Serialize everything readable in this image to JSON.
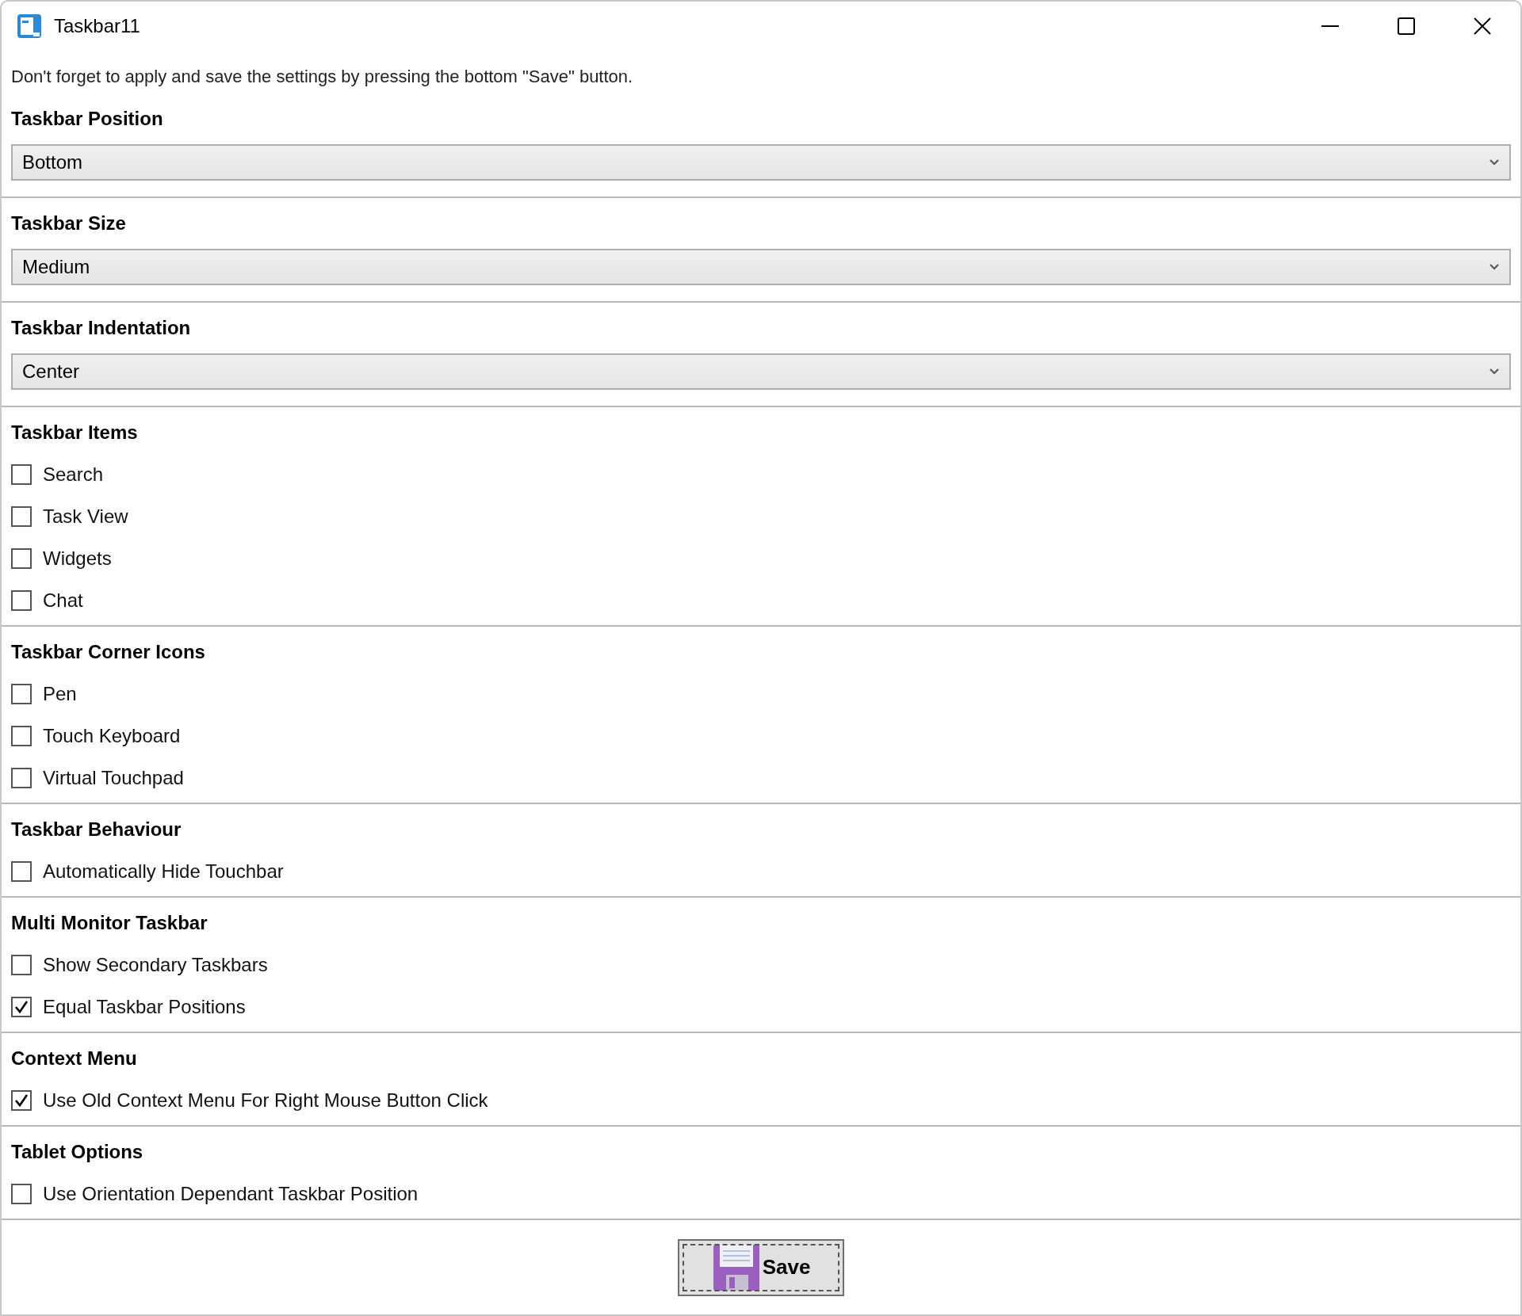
{
  "window": {
    "title": "Taskbar11"
  },
  "notice": "Don't forget to apply and save the settings by pressing the bottom \"Save\" button.",
  "sections": [
    {
      "title": "Taskbar Position",
      "kind": "dropdown",
      "value": "Bottom"
    },
    {
      "title": "Taskbar Size",
      "kind": "dropdown",
      "value": "Medium"
    },
    {
      "title": "Taskbar Indentation",
      "kind": "dropdown",
      "value": "Center"
    },
    {
      "title": "Taskbar Items",
      "kind": "checkboxes",
      "options": [
        {
          "label": "Search",
          "checked": false
        },
        {
          "label": "Task View",
          "checked": false
        },
        {
          "label": "Widgets",
          "checked": false
        },
        {
          "label": "Chat",
          "checked": false
        }
      ]
    },
    {
      "title": "Taskbar Corner Icons",
      "kind": "checkboxes",
      "options": [
        {
          "label": "Pen",
          "checked": false
        },
        {
          "label": "Touch Keyboard",
          "checked": false
        },
        {
          "label": "Virtual Touchpad",
          "checked": false
        }
      ]
    },
    {
      "title": "Taskbar Behaviour",
      "kind": "checkboxes",
      "options": [
        {
          "label": "Automatically Hide Touchbar",
          "checked": false
        }
      ]
    },
    {
      "title": "Multi Monitor Taskbar",
      "kind": "checkboxes",
      "options": [
        {
          "label": "Show Secondary Taskbars",
          "checked": false
        },
        {
          "label": "Equal Taskbar Positions",
          "checked": true
        }
      ]
    },
    {
      "title": "Context Menu",
      "kind": "checkboxes",
      "options": [
        {
          "label": "Use Old Context Menu For Right Mouse Button Click",
          "checked": true
        }
      ]
    },
    {
      "title": "Tablet Options",
      "kind": "checkboxes",
      "options": [
        {
          "label": "Use Orientation Dependant Taskbar Position",
          "checked": false
        }
      ]
    }
  ],
  "save_button": "Save"
}
